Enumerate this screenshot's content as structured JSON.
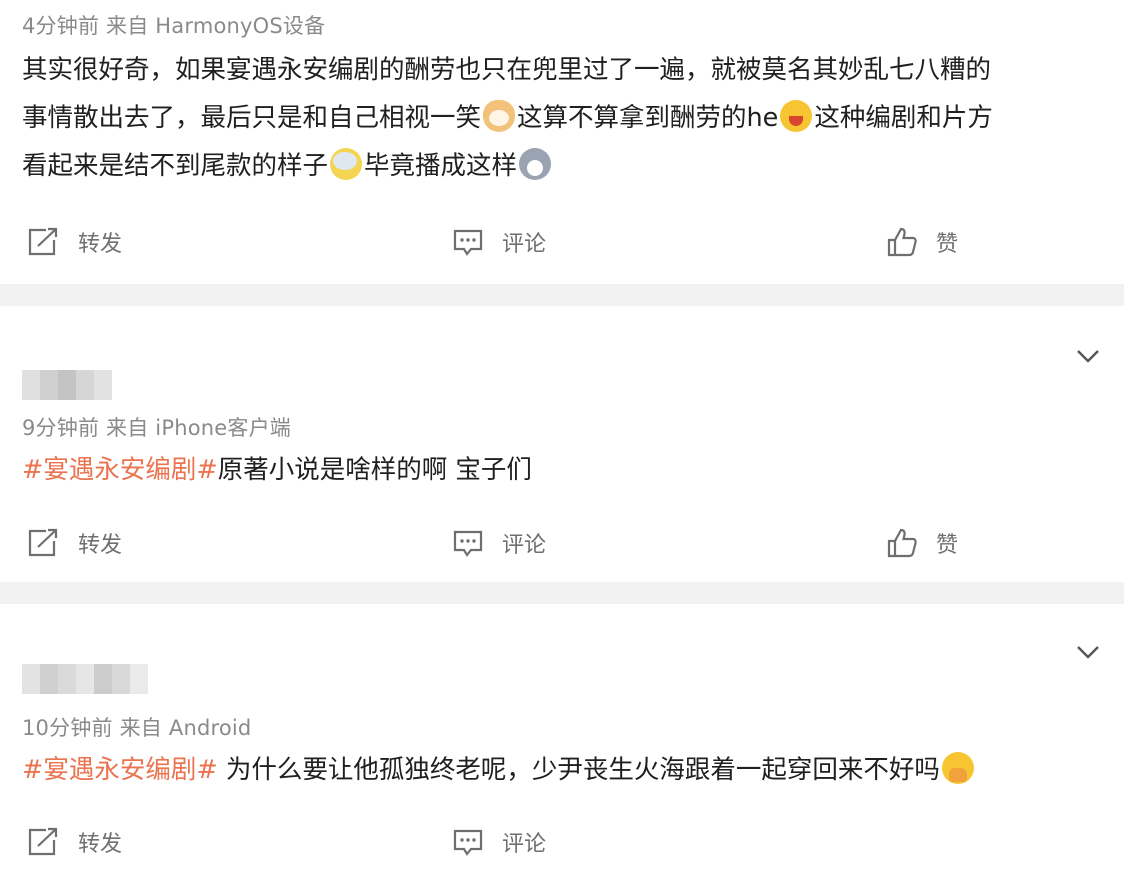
{
  "posts": [
    {
      "meta": "4分钟前  来自 HarmonyOS设备",
      "lines": [
        [
          "其实很好奇，如果宴遇永安编剧的酬劳也只在兜里过了一遍，就被莫名其妙乱七八糟的"
        ],
        [
          "事情散出去了，最后只是和自己相视一笑",
          "这算不算拿到酬劳的he",
          "这种编剧和片方"
        ],
        [
          "看起来是结不到尾款的样子",
          "毕竟播成这样"
        ]
      ],
      "emojis": [
        "dog-emoji",
        "laugh-emoji",
        "sweat-emoji",
        "husky-emoji"
      ]
    },
    {
      "meta": "9分钟前  来自 iPhone客户端",
      "topic": "#宴遇永安编剧#",
      "text": "原著小说是啥样的啊 宝子们"
    },
    {
      "meta": "10分钟前  来自 Android",
      "topic": "#宴遇永安编剧#",
      "text": " 为什么要让他孤独终老呢，少尹丧生火海跟着一起穿回来不好吗",
      "emojis": [
        "pray-emoji"
      ]
    }
  ],
  "actions": {
    "repost": "转发",
    "comment": "评论",
    "like": "赞"
  },
  "colors": {
    "topic": "#eb7350",
    "separator": "#f2f2f2",
    "meta": "#8a8a8a",
    "action": "#6f6f6f"
  }
}
